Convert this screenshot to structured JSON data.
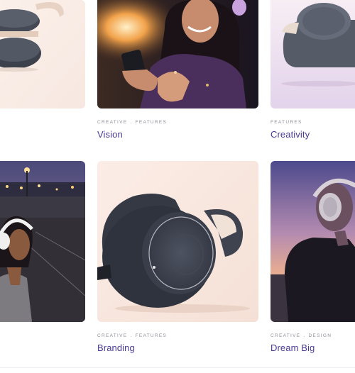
{
  "portfolio": {
    "items": [
      {
        "id": "headphones-stack",
        "title": "",
        "categories": [],
        "image": "white-headphones-stack-photo",
        "accent": "#f8ece4"
      },
      {
        "id": "vision",
        "title": "Vision",
        "categories": [
          "CREATIVE",
          "FEATURES"
        ],
        "image": "woman-with-phone-night-photo",
        "accent": "#3a2430"
      },
      {
        "id": "creativity",
        "title": "Creativity",
        "categories": [
          "FEATURES"
        ],
        "image": "gray-headphones-lavender-photo",
        "accent": "#e8dcef"
      },
      {
        "id": "city-night",
        "title": "",
        "categories": [],
        "image": "woman-headphones-city-night-photo",
        "accent": "#2a2838"
      },
      {
        "id": "branding",
        "title": "Branding",
        "categories": [
          "CREATIVE",
          "FEATURES"
        ],
        "image": "dark-headphones-peach-photo",
        "accent": "#f7e4da"
      },
      {
        "id": "dream-big",
        "title": "Dream Big",
        "categories": [
          "CREATIVE",
          "DESIGN"
        ],
        "image": "man-headphones-sunset-photo",
        "accent": "#8d7fb4"
      }
    ],
    "colors": {
      "title": "#4b3b95",
      "category": "#8e8e99"
    }
  }
}
